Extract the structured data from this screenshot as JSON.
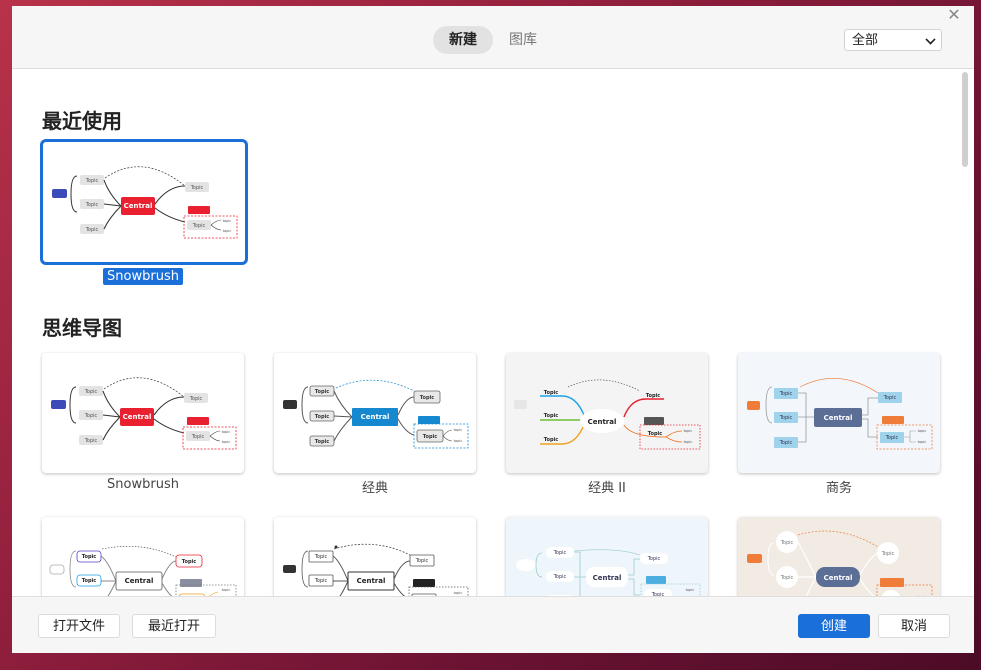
{
  "header": {
    "tabs": [
      {
        "label": "新建",
        "active": true
      },
      {
        "label": "图库",
        "active": false
      }
    ],
    "filter": {
      "selected": "全部"
    },
    "close_icon": "close-icon"
  },
  "sections": {
    "recent": {
      "title": "最近使用",
      "items": [
        {
          "label": "Snowbrush",
          "selected": true
        }
      ]
    },
    "mindmap": {
      "title": "思维导图",
      "items": [
        {
          "label": "Snowbrush"
        },
        {
          "label": "经典"
        },
        {
          "label": "经典 II"
        },
        {
          "label": "商务"
        },
        {
          "label": ""
        },
        {
          "label": ""
        },
        {
          "label": ""
        },
        {
          "label": ""
        }
      ]
    }
  },
  "thumb_text": {
    "central": "Central",
    "topic": "Topic",
    "small_topic": "topic"
  },
  "footer": {
    "open_file": "打开文件",
    "recent_open": "最近打开",
    "create": "创建",
    "cancel": "取消"
  },
  "colors": {
    "accent": "#1a6fd8",
    "snowbrush_central": "#e8202f",
    "classic_central": "#1588cf",
    "business_central": "#5a6e96"
  }
}
